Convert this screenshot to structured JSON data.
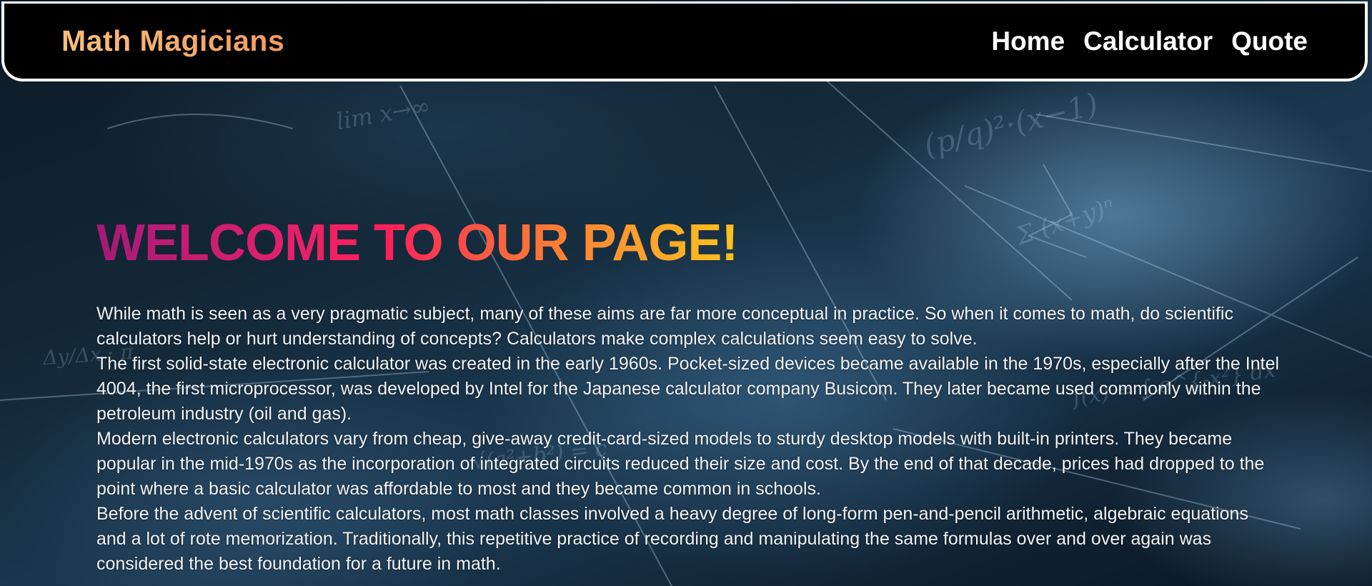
{
  "navbar": {
    "brand": "Math Magicians",
    "links": [
      {
        "label": "Home"
      },
      {
        "label": "Calculator"
      },
      {
        "label": "Quote"
      }
    ]
  },
  "main": {
    "title": "WELCOME TO OUR PAGE!",
    "paragraphs": [
      "While math is seen as a very pragmatic subject, many of these aims are far more conceptual in practice. So when it comes to math, do scientific calculators help or hurt understanding of concepts? Calculators make complex calculations seem easy to solve.",
      "The first solid-state electronic calculator was created in the early 1960s. Pocket-sized devices became available in the 1970s, especially after the Intel 4004, the first microprocessor, was developed by Intel for the Japanese calculator company Busicom. They later became used commonly within the petroleum industry (oil and gas).",
      "Modern electronic calculators vary from cheap, give-away credit-card-sized models to sturdy desktop models with built-in printers. They became popular in the mid-1970s as the incorporation of integrated circuits reduced their size and cost. By the end of that decade, prices had dropped to the point where a basic calculator was affordable to most and they became common in schools.",
      "Before the advent of scientific calculators, most math classes involved a heavy degree of long-form pen-and-pencil arithmetic, algebraic equations and a lot of rote memorization. Traditionally, this repetitive practice of recording and manipulating the same formulas over and over again was considered the best foundation for a future in math."
    ]
  },
  "colors": {
    "navbar_bg": "#000000",
    "navbar_border": "#ffffff",
    "brand_gradient": [
      "#f7bf7f",
      "#f39a60"
    ],
    "title_gradient": [
      "#a51a78",
      "#ff1f5a",
      "#ffc21b"
    ],
    "body_text": "#f2f4f7"
  }
}
